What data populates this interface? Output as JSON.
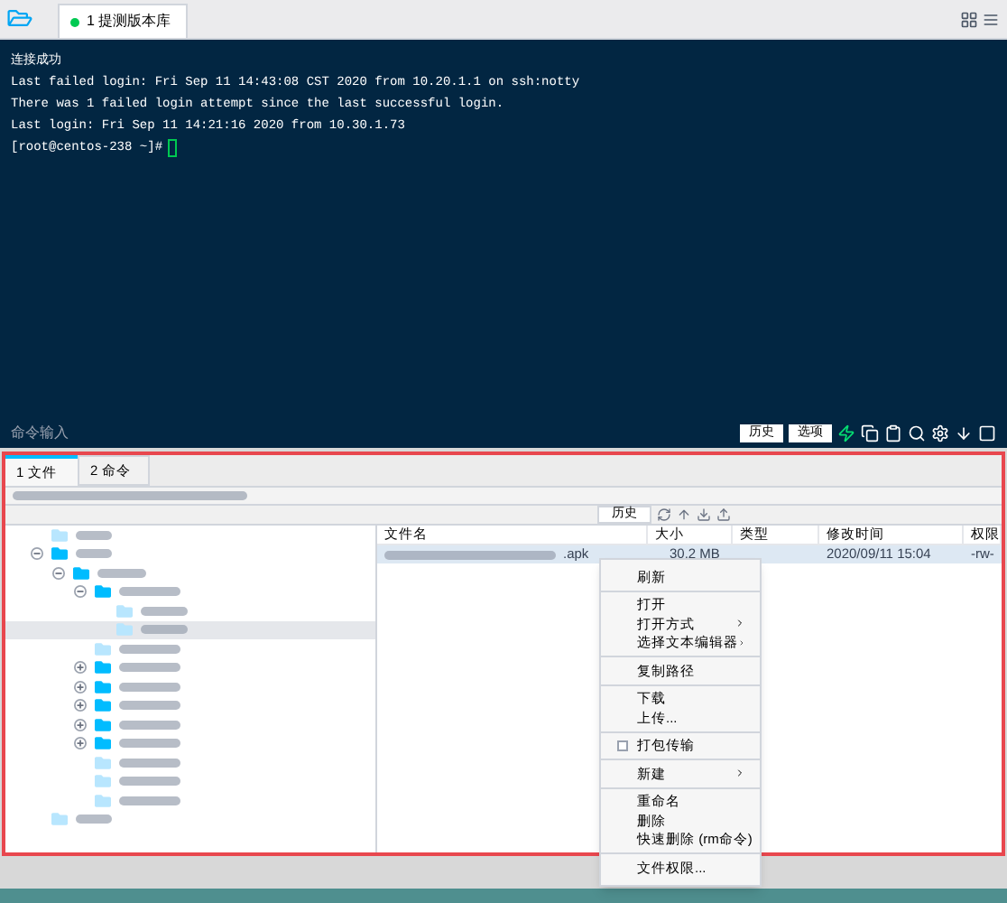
{
  "session_tabs": [
    {
      "label": "1 提测版本库",
      "connected": true,
      "selected": true
    }
  ],
  "terminal": {
    "lines": [
      "连接成功",
      "Last failed login: Fri Sep 11 14:43:08 CST 2020 from 10.20.1.1 on ssh:notty",
      "There was 1 failed login attempt since the last successful login.",
      "Last login: Fri Sep 11 14:21:16 2020 from 10.30.1.73"
    ],
    "prompt": "[root@centos-238 ~]#",
    "input_label": "命令输入",
    "buttons": [
      "历史",
      "选项"
    ]
  },
  "panel_tabs": [
    {
      "label": "1 文件",
      "selected": true
    },
    {
      "label": "2 命令",
      "selected": false
    }
  ],
  "history_button": "历史",
  "tree": [
    {
      "selected": false
    },
    {
      "expanded": true,
      "selected": false,
      "children": [
        {
          "expanded": true,
          "selected": false,
          "children": [
            {
              "expanded": true,
              "selected": false,
              "children": [
                {
                  "selected": false
                },
                {
                  "selected": true
                }
              ]
            },
            {
              "selected": false
            },
            {
              "expanded": false,
              "selected": false
            },
            {
              "expanded": false,
              "selected": false
            },
            {
              "expanded": false,
              "selected": false
            },
            {
              "expanded": false,
              "selected": false
            },
            {
              "expanded": false,
              "selected": false
            },
            {
              "selected": false
            },
            {
              "selected": false
            },
            {
              "selected": false
            }
          ]
        }
      ]
    },
    {
      "selected": false
    }
  ],
  "table": {
    "columns": [
      "文件名",
      "大小",
      "类型",
      "修改时间",
      "权限"
    ],
    "rows": [
      {
        "name": ".apk",
        "size": "30.2 MB",
        "modified": "2020/09/11 15:04",
        "permissions": "-rw-",
        "selected": true
      }
    ]
  },
  "context_menu": [
    [
      {
        "kind": "item",
        "label": "刷新"
      }
    ],
    [
      {
        "kind": "item",
        "label": "打开"
      },
      {
        "kind": "submenu",
        "label": "打开方式"
      },
      {
        "kind": "submenu",
        "label": "选择文本编辑器"
      }
    ],
    [
      {
        "kind": "item",
        "label": "复制路径"
      }
    ],
    [
      {
        "kind": "item",
        "label": "下载"
      },
      {
        "kind": "item",
        "label": "上传..."
      }
    ],
    [
      {
        "kind": "check",
        "label": "打包传输",
        "checked": false
      }
    ],
    [
      {
        "kind": "submenu",
        "label": "新建"
      }
    ],
    [
      {
        "kind": "item",
        "label": "重命名"
      },
      {
        "kind": "item",
        "label": "删除"
      },
      {
        "kind": "item",
        "label": "快速删除 (rm命令)"
      }
    ],
    [
      {
        "kind": "item",
        "label": "文件权限..."
      }
    ]
  ]
}
